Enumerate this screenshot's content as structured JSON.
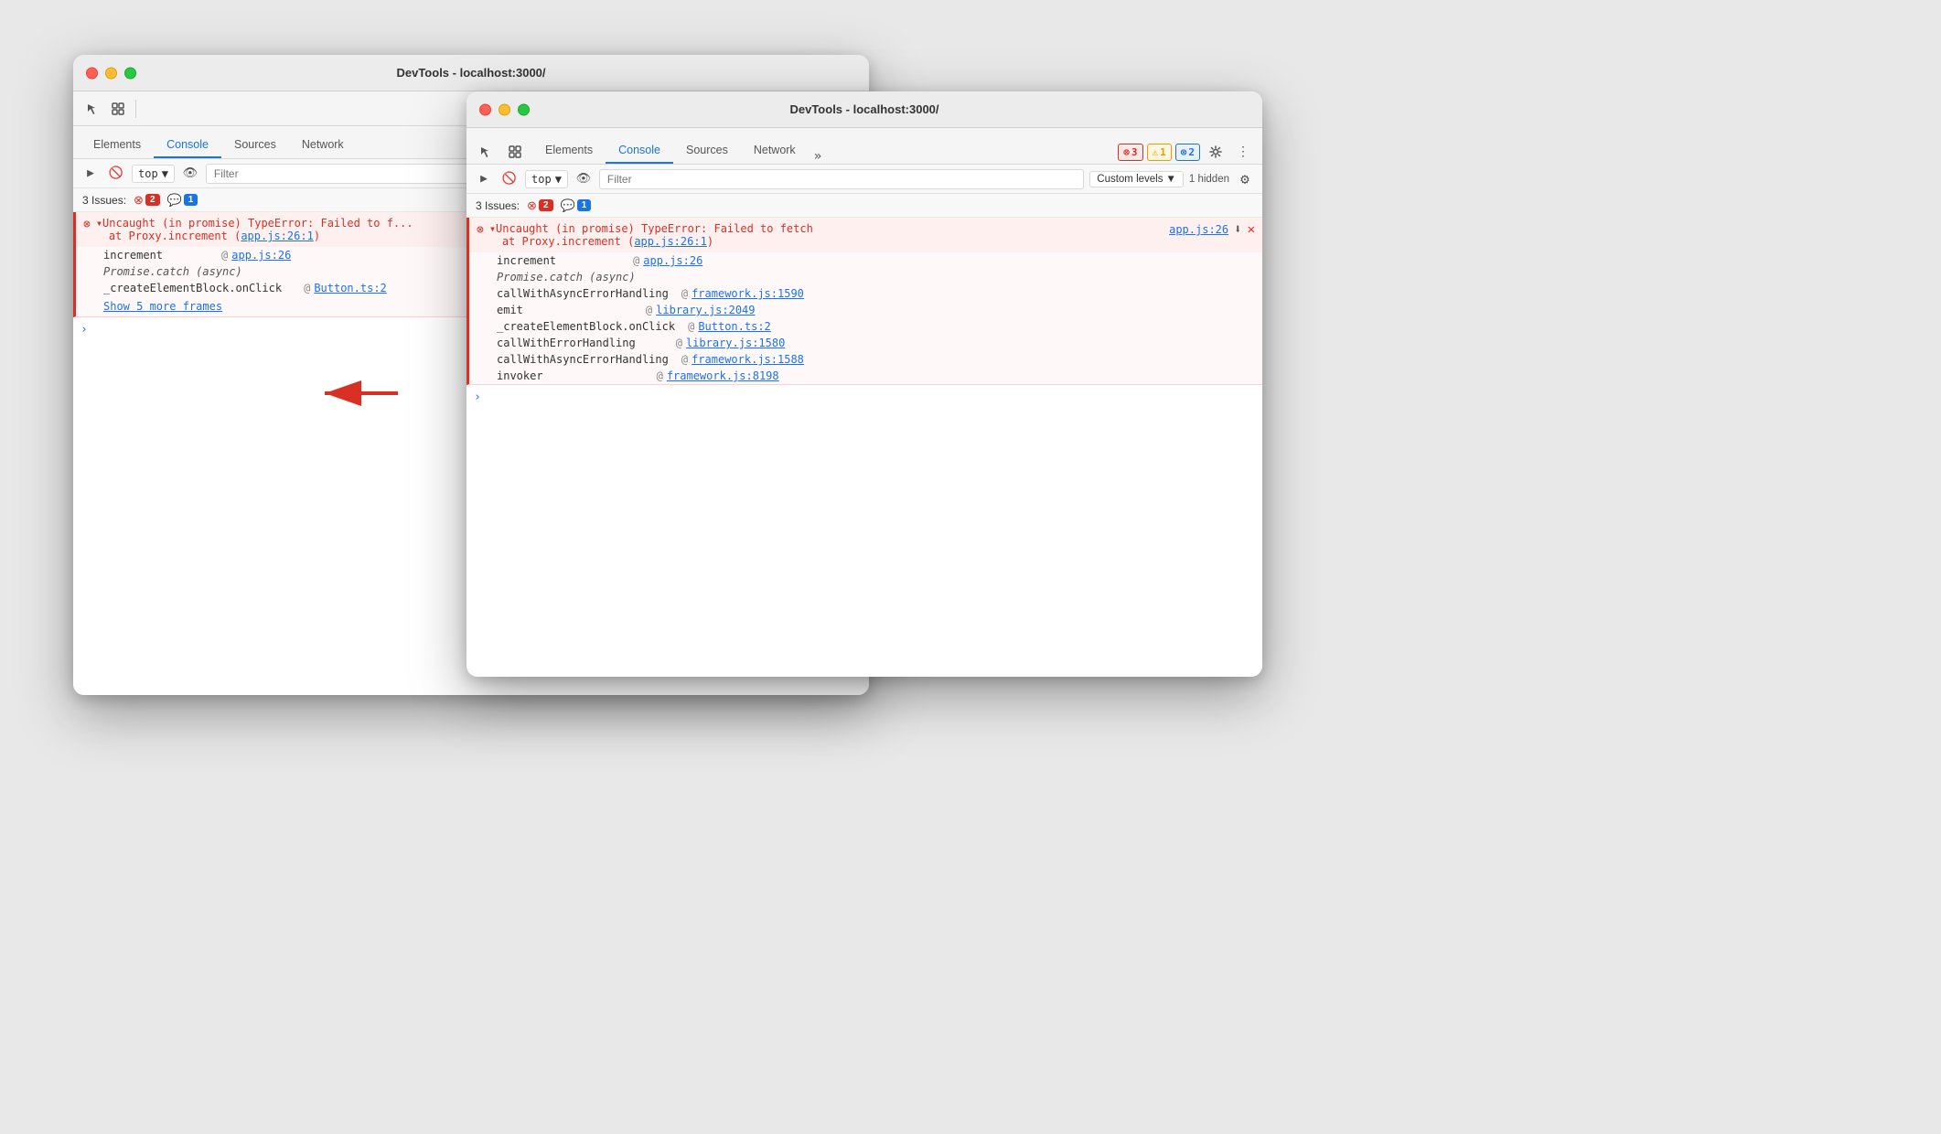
{
  "window_back": {
    "title": "DevTools - localhost:3000/",
    "tabs": [
      "Elements",
      "Console",
      "Sources",
      "Network"
    ],
    "active_tab": "Console",
    "filter_placeholder": "Filter",
    "top_label": "top",
    "issues_label": "3 Issues:",
    "error_badge": "2",
    "info_badge": "1",
    "error_message": "▾Uncaught (in promise) TypeError: Failed to f...",
    "error_line1": "▾Uncaught (in promise) TypeError: Failed to f",
    "error_at": "at Proxy.increment (app.js:26:1)",
    "stack": [
      {
        "func": "increment",
        "at": "@",
        "file": "app.js:26"
      },
      {
        "func": "Promise.catch (async)",
        "at": "",
        "file": ""
      },
      {
        "func": "_createElementBlock.onClick",
        "at": "@",
        "file": "Button.ts:2"
      }
    ],
    "show_more": "Show 5 more frames"
  },
  "window_front": {
    "title": "DevTools - localhost:3000/",
    "tabs": [
      "Elements",
      "Console",
      "Sources",
      "Network"
    ],
    "active_tab": "Console",
    "filter_placeholder": "Filter",
    "top_label": "top",
    "custom_levels": "Custom levels",
    "hidden_label": "1 hidden",
    "issues_label": "3 Issues:",
    "error_badge": "2",
    "info_badge": "1",
    "error_badge_count": "3",
    "warning_badge_count": "1",
    "info_badge_count": "2",
    "error_message_main": "▾Uncaught (in promise) TypeError: Failed to fetch",
    "error_at_main": "at Proxy.increment (app.js:26:1)",
    "error_file": "app.js:26",
    "stack": [
      {
        "func": "increment",
        "at": "@",
        "file": "app.js:26",
        "is_link": true
      },
      {
        "func": "Promise.catch (async)",
        "at": "",
        "file": "",
        "is_link": false
      },
      {
        "func": "callWithAsyncErrorHandling",
        "at": "@",
        "file": "framework.js:1590",
        "is_link": true
      },
      {
        "func": "emit",
        "at": "@",
        "file": "library.js:2049",
        "is_link": true
      },
      {
        "func": "_createElementBlock.onClick",
        "at": "@",
        "file": "Button.ts:2",
        "is_link": true
      },
      {
        "func": "callWithErrorHandling",
        "at": "@",
        "file": "library.js:1580",
        "is_link": true
      },
      {
        "func": "callWithAsyncErrorHandling",
        "at": "@",
        "file": "framework.js:1588",
        "is_link": true
      },
      {
        "func": "invoker",
        "at": "@",
        "file": "framework.js:8198",
        "is_link": true
      }
    ]
  },
  "arrow": {
    "direction": "pointing left"
  }
}
